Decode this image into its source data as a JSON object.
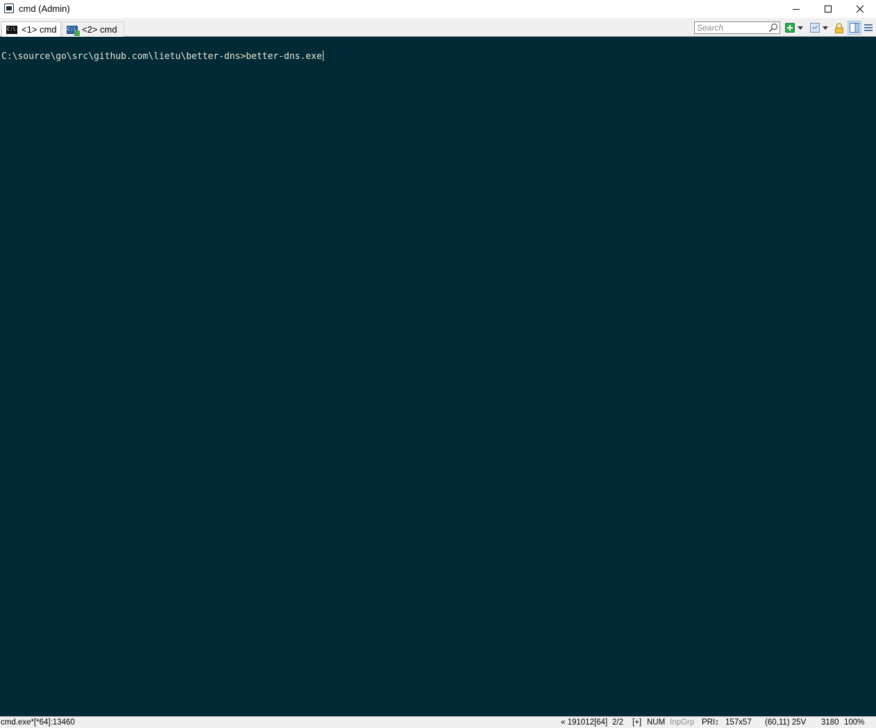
{
  "window": {
    "title": "cmd (Admin)"
  },
  "tabs": [
    {
      "label": "<1> cmd",
      "active": true
    },
    {
      "label": "<2> cmd",
      "active": false
    }
  ],
  "toolbar": {
    "search_placeholder": "Search",
    "icons": [
      "search-icon",
      "add-console-icon",
      "dropdown-arrow-icon",
      "view-icon",
      "dropdown-arrow-icon",
      "lock-icon",
      "panel-icon",
      "menu-icon"
    ]
  },
  "console": {
    "prompt": "C:\\source\\go\\src\\github.com\\lietu\\better-dns>",
    "command": "better-dns.exe"
  },
  "status": {
    "process": "cmd.exe*[*64]:13460",
    "build": "« 191012[64]",
    "page": "2/2",
    "plus": "[+]",
    "num": "NUM",
    "inpgrp": "InpGrp",
    "pri": "PRI↕",
    "size": "157x57",
    "cursor": "(60,11) 25V",
    "pid": "3180",
    "zoom": "100%"
  },
  "colors": {
    "console_bg": "#002b36",
    "console_fg": "#eee8d5",
    "chrome_bg": "#f0f0f0",
    "add_accent": "#2fa84f"
  }
}
